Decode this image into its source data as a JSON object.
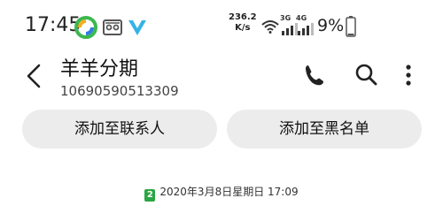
{
  "status_bar": {
    "time": "17:45",
    "net_speed_value": "236.2",
    "net_speed_unit": "K/s",
    "signal_1_label": "3G",
    "signal_2_label": "4G",
    "battery_percent": "9%",
    "icons": [
      "round-app-icon",
      "cassette-icon",
      "v-logo-icon",
      "wifi-icon",
      "signal-3g-icon",
      "signal-4g-icon",
      "battery-icon"
    ]
  },
  "header": {
    "title": "羊羊分期",
    "phone_number": "10690590513309",
    "actions": [
      "call-icon",
      "search-icon",
      "more-icon"
    ]
  },
  "buttons": {
    "add_contact": "添加至联系人",
    "add_blacklist": "添加至黑名单"
  },
  "message": {
    "sim_slot": "2",
    "timestamp": "2020年3月8日星期日 17:09"
  }
}
